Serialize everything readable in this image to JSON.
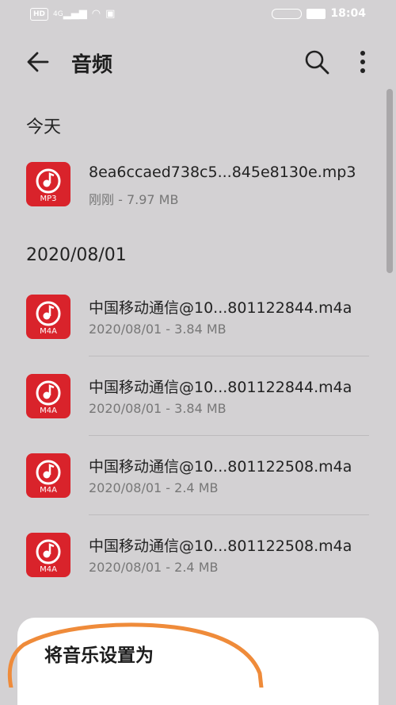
{
  "status_bar": {
    "network_badge": "HD",
    "signal_label": "4G",
    "time": "18:04"
  },
  "appbar": {
    "title": "音频"
  },
  "sections": [
    {
      "header": "今天"
    },
    {
      "header": "2020/08/01"
    }
  ],
  "files": [
    {
      "name": "8ea6ccaed738c5...845e8130e.mp3",
      "meta": "刚刚 - 7.97 MB",
      "ext": "MP3"
    },
    {
      "name": "中国移动通信@10...801122844.m4a",
      "meta": "2020/08/01 - 3.84 MB",
      "ext": "M4A"
    },
    {
      "name": "中国移动通信@10...801122844.m4a",
      "meta": "2020/08/01 - 3.84 MB",
      "ext": "M4A"
    },
    {
      "name": "中国移动通信@10...801122508.m4a",
      "meta": "2020/08/01 - 2.4 MB",
      "ext": "M4A"
    },
    {
      "name": "中国移动通信@10...801122508.m4a",
      "meta": "2020/08/01 - 2.4 MB",
      "ext": "M4A"
    }
  ],
  "sheet": {
    "title": "将音乐设置为"
  },
  "colors": {
    "icon_red": "#d9232b",
    "background": "#d3d1d3",
    "annotation_orange": "#ef8b3a"
  }
}
